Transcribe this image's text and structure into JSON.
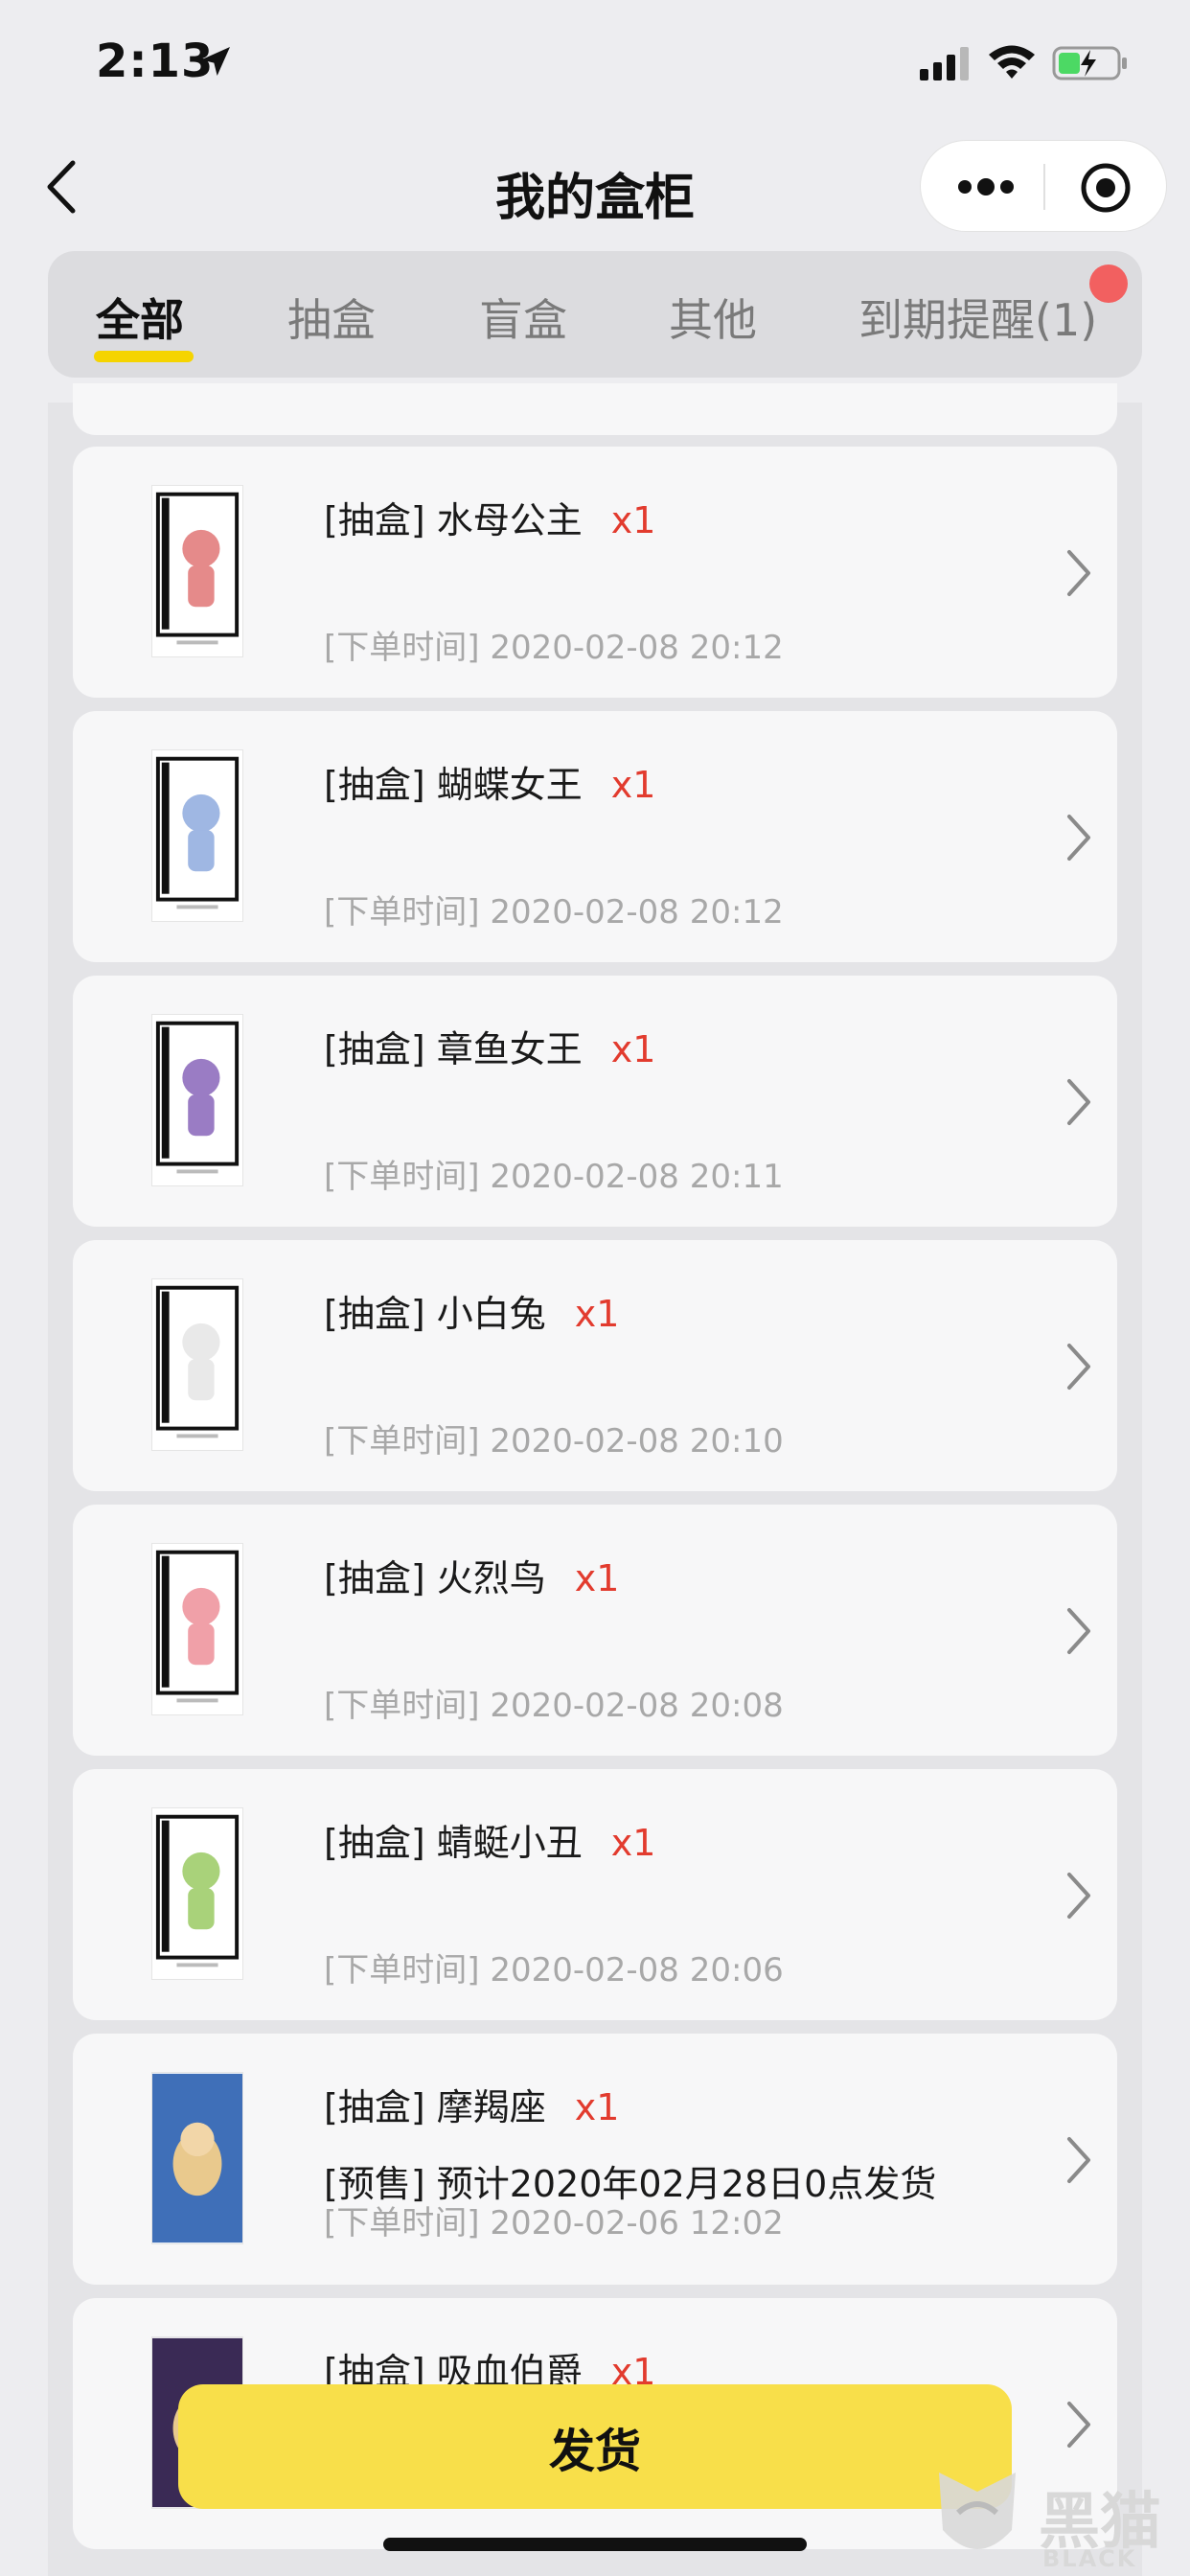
{
  "status": {
    "time": "2:13",
    "icons": [
      "location-arrow-icon",
      "signal-icon",
      "wifi-icon",
      "battery-charging-icon"
    ]
  },
  "nav": {
    "title": "我的盒柜",
    "back_icon": "chevron-left-icon",
    "more_icon": "more-dots-icon",
    "close_icon": "target-circle-icon"
  },
  "tabs": [
    {
      "label": "全部",
      "active": true
    },
    {
      "label": "抽盒",
      "active": false
    },
    {
      "label": "盲盒",
      "active": false
    },
    {
      "label": "其他",
      "active": false
    },
    {
      "label": "到期提醒(1)",
      "active": false
    }
  ],
  "items": [
    {
      "title": "[抽盒] 水母公主",
      "qty": "x1",
      "time": "[下单时间] 2020-02-08 20:12",
      "thumb_color": "#e58a8a"
    },
    {
      "title": "[抽盒] 蝴蝶女王",
      "qty": "x1",
      "time": "[下单时间] 2020-02-08 20:12",
      "thumb_color": "#9fb7e3"
    },
    {
      "title": "[抽盒] 章鱼女王",
      "qty": "x1",
      "time": "[下单时间] 2020-02-08 20:11",
      "thumb_color": "#9a7cc4"
    },
    {
      "title": "[抽盒] 小白兔",
      "qty": "x1",
      "time": "[下单时间] 2020-02-08 20:10",
      "thumb_color": "#e9e9e9"
    },
    {
      "title": "[抽盒] 火烈鸟",
      "qty": "x1",
      "time": "[下单时间] 2020-02-08 20:08",
      "thumb_color": "#f0a0a8"
    },
    {
      "title": "[抽盒] 蜻蜓小丑",
      "qty": "x1",
      "time": "[下单时间] 2020-02-08 20:06",
      "thumb_color": "#a9d27a"
    },
    {
      "title": "[抽盒] 摩羯座",
      "qty": "x1",
      "presale": "[预售] 预计2020年02月28日0点发货",
      "time": "[下单时间] 2020-02-06 12:02",
      "thumb_color": "#3f6fb8"
    },
    {
      "title": "[抽盒] 吸血伯爵",
      "qty": "x1",
      "time": "",
      "thumb_color": "#3a2a55"
    }
  ],
  "ship_button": "发货",
  "watermark": {
    "text": "黑猫",
    "sub": "BLACK CAT"
  },
  "colors": {
    "accent": "#f8df4a",
    "tab_underline": "#f5d400",
    "qty": "#e23b2e",
    "badge": "#f26060"
  }
}
